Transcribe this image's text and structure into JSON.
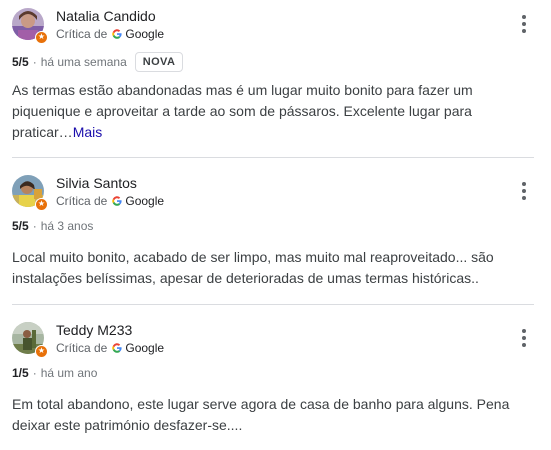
{
  "reviews": [
    {
      "name": "Natalia Candido",
      "critic_prefix": "Crítica de",
      "critic_source": "Google",
      "score": "5/5",
      "time": "há uma semana",
      "badge": "NOVA",
      "text": "As termas estão abandonadas mas é um lugar muito bonito para fazer um piquenique e aproveitar a tarde ao som de pássaros. Excelente lugar para praticar…",
      "more": "Mais"
    },
    {
      "name": "Silvia Santos",
      "critic_prefix": "Crítica de",
      "critic_source": "Google",
      "score": "5/5",
      "time": "há 3 anos",
      "text": "Local muito bonito, acabado de ser limpo, mas muito mal reaproveitado... são instalações belíssimas, apesar de deterioradas de umas termas históricas.."
    },
    {
      "name": "Teddy M233",
      "critic_prefix": "Crítica de",
      "critic_source": "Google",
      "score": "1/5",
      "time": "há um ano",
      "text": "Em total abandono, este lugar serve agora de casa de banho para alguns. Pena deixar este património desfazer-se...."
    }
  ],
  "separator": "·",
  "icons": {
    "avatar_badge": "local-guide-star-icon",
    "google": "google-g-icon",
    "menu": "more-vert-icon"
  },
  "colors": {
    "link": "#1a0dab",
    "badge": "#e8710a",
    "text": "#3c4043",
    "meta": "#70757a"
  }
}
